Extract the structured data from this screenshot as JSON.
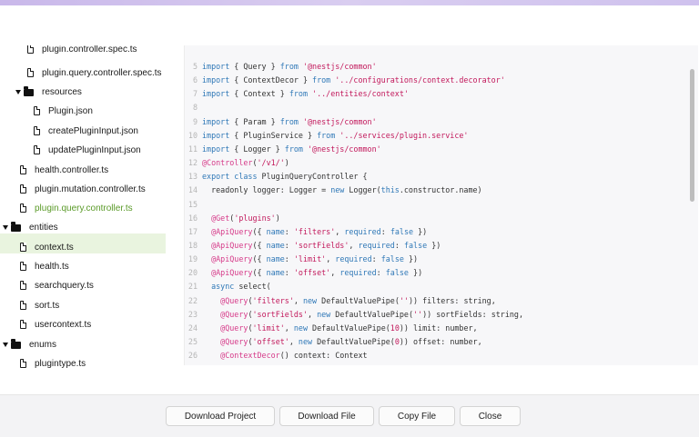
{
  "tree": {
    "items": [
      {
        "label": "plugin.controller.spec.ts",
        "type": "file"
      },
      {
        "label": "plugin.query.controller.spec.ts",
        "type": "file"
      },
      {
        "label": "resources",
        "type": "folder"
      },
      {
        "label": "Plugin.json",
        "type": "file"
      },
      {
        "label": "createPluginInput.json",
        "type": "file"
      },
      {
        "label": "updatePluginInput.json",
        "type": "file"
      },
      {
        "label": "health.controller.ts",
        "type": "file"
      },
      {
        "label": "plugin.mutation.controller.ts",
        "type": "file"
      },
      {
        "label": "plugin.query.controller.ts",
        "type": "file",
        "selected": true
      },
      {
        "label": "entities",
        "type": "folder"
      },
      {
        "label": "context.ts",
        "type": "file"
      },
      {
        "label": "health.ts",
        "type": "file"
      },
      {
        "label": "searchquery.ts",
        "type": "file"
      },
      {
        "label": "sort.ts",
        "type": "file"
      },
      {
        "label": "usercontext.ts",
        "type": "file"
      },
      {
        "label": "enums",
        "type": "folder"
      },
      {
        "label": "plugintype.ts",
        "type": "file"
      }
    ]
  },
  "editor": {
    "lines": [
      {
        "n": "5",
        "segs": [
          [
            "kw",
            "import"
          ],
          [
            "plain",
            " { Query } "
          ],
          [
            "kw",
            "from"
          ],
          [
            "plain",
            " "
          ],
          [
            "str",
            "'@nestjs/common'"
          ]
        ]
      },
      {
        "n": "6",
        "segs": [
          [
            "kw",
            "import"
          ],
          [
            "plain",
            " { ContextDecor } "
          ],
          [
            "kw",
            "from"
          ],
          [
            "plain",
            " "
          ],
          [
            "str",
            "'../configurations/context.decorator'"
          ]
        ]
      },
      {
        "n": "7",
        "segs": [
          [
            "kw",
            "import"
          ],
          [
            "plain",
            " { Context } "
          ],
          [
            "kw",
            "from"
          ],
          [
            "plain",
            " "
          ],
          [
            "str",
            "'../entities/context'"
          ]
        ]
      },
      {
        "n": "8",
        "segs": []
      },
      {
        "n": "9",
        "segs": [
          [
            "kw",
            "import"
          ],
          [
            "plain",
            " { Param } "
          ],
          [
            "kw",
            "from"
          ],
          [
            "plain",
            " "
          ],
          [
            "str",
            "'@nestjs/common'"
          ]
        ]
      },
      {
        "n": "10",
        "segs": [
          [
            "kw",
            "import"
          ],
          [
            "plain",
            " { PluginService } "
          ],
          [
            "kw",
            "from"
          ],
          [
            "plain",
            " "
          ],
          [
            "str",
            "'../services/plugin.service'"
          ]
        ]
      },
      {
        "n": "11",
        "segs": [
          [
            "kw",
            "import"
          ],
          [
            "plain",
            " { Logger } "
          ],
          [
            "kw",
            "from"
          ],
          [
            "plain",
            " "
          ],
          [
            "str",
            "'@nestjs/common'"
          ]
        ]
      },
      {
        "n": "12",
        "segs": [
          [
            "dec",
            "@Controller"
          ],
          [
            "plain",
            "("
          ],
          [
            "str",
            "'/v1/'"
          ],
          [
            "plain",
            ")"
          ]
        ]
      },
      {
        "n": "13",
        "segs": [
          [
            "kw",
            "export class"
          ],
          [
            "plain",
            " PluginQueryController {"
          ]
        ]
      },
      {
        "n": "14",
        "segs": [
          [
            "plain",
            "  readonly logger: Logger = "
          ],
          [
            "kw",
            "new"
          ],
          [
            "plain",
            " Logger("
          ],
          [
            "kw",
            "this"
          ],
          [
            "plain",
            ".constructor.name)"
          ]
        ]
      },
      {
        "n": "15",
        "segs": []
      },
      {
        "n": "16",
        "segs": [
          [
            "plain",
            "  "
          ],
          [
            "dec",
            "@Get"
          ],
          [
            "plain",
            "("
          ],
          [
            "str",
            "'plugins'"
          ],
          [
            "plain",
            ")"
          ]
        ]
      },
      {
        "n": "17",
        "segs": [
          [
            "plain",
            "  "
          ],
          [
            "dec",
            "@ApiQuery"
          ],
          [
            "plain",
            "({ "
          ],
          [
            "kw",
            "name"
          ],
          [
            "plain",
            ": "
          ],
          [
            "str",
            "'filters'"
          ],
          [
            "plain",
            ", "
          ],
          [
            "kw",
            "required"
          ],
          [
            "plain",
            ": "
          ],
          [
            "kw",
            "false"
          ],
          [
            "plain",
            " })"
          ]
        ]
      },
      {
        "n": "18",
        "segs": [
          [
            "plain",
            "  "
          ],
          [
            "dec",
            "@ApiQuery"
          ],
          [
            "plain",
            "({ "
          ],
          [
            "kw",
            "name"
          ],
          [
            "plain",
            ": "
          ],
          [
            "str",
            "'sortFields'"
          ],
          [
            "plain",
            ", "
          ],
          [
            "kw",
            "required"
          ],
          [
            "plain",
            ": "
          ],
          [
            "kw",
            "false"
          ],
          [
            "plain",
            " })"
          ]
        ]
      },
      {
        "n": "19",
        "segs": [
          [
            "plain",
            "  "
          ],
          [
            "dec",
            "@ApiQuery"
          ],
          [
            "plain",
            "({ "
          ],
          [
            "kw",
            "name"
          ],
          [
            "plain",
            ": "
          ],
          [
            "str",
            "'limit'"
          ],
          [
            "plain",
            ", "
          ],
          [
            "kw",
            "required"
          ],
          [
            "plain",
            ": "
          ],
          [
            "kw",
            "false"
          ],
          [
            "plain",
            " })"
          ]
        ]
      },
      {
        "n": "20",
        "segs": [
          [
            "plain",
            "  "
          ],
          [
            "dec",
            "@ApiQuery"
          ],
          [
            "plain",
            "({ "
          ],
          [
            "kw",
            "name"
          ],
          [
            "plain",
            ": "
          ],
          [
            "str",
            "'offset'"
          ],
          [
            "plain",
            ", "
          ],
          [
            "kw",
            "required"
          ],
          [
            "plain",
            ": "
          ],
          [
            "kw",
            "false"
          ],
          [
            "plain",
            " })"
          ]
        ]
      },
      {
        "n": "21",
        "segs": [
          [
            "plain",
            "  "
          ],
          [
            "kw",
            "async"
          ],
          [
            "plain",
            " select("
          ]
        ]
      },
      {
        "n": "22",
        "segs": [
          [
            "plain",
            "    "
          ],
          [
            "dec",
            "@Query"
          ],
          [
            "plain",
            "("
          ],
          [
            "str",
            "'filters'"
          ],
          [
            "plain",
            ", "
          ],
          [
            "kw",
            "new"
          ],
          [
            "plain",
            " DefaultValuePipe("
          ],
          [
            "str",
            "''"
          ],
          [
            "plain",
            ")) filters: string,"
          ]
        ]
      },
      {
        "n": "23",
        "segs": [
          [
            "plain",
            "    "
          ],
          [
            "dec",
            "@Query"
          ],
          [
            "plain",
            "("
          ],
          [
            "str",
            "'sortFields'"
          ],
          [
            "plain",
            ", "
          ],
          [
            "kw",
            "new"
          ],
          [
            "plain",
            " DefaultValuePipe("
          ],
          [
            "str",
            "''"
          ],
          [
            "plain",
            ")) sortFields: string,"
          ]
        ]
      },
      {
        "n": "24",
        "segs": [
          [
            "plain",
            "    "
          ],
          [
            "dec",
            "@Query"
          ],
          [
            "plain",
            "("
          ],
          [
            "str",
            "'limit'"
          ],
          [
            "plain",
            ", "
          ],
          [
            "kw",
            "new"
          ],
          [
            "plain",
            " DefaultValuePipe("
          ],
          [
            "str",
            "10"
          ],
          [
            "plain",
            ")) limit: number,"
          ]
        ]
      },
      {
        "n": "25",
        "segs": [
          [
            "plain",
            "    "
          ],
          [
            "dec",
            "@Query"
          ],
          [
            "plain",
            "("
          ],
          [
            "str",
            "'offset'"
          ],
          [
            "plain",
            ", "
          ],
          [
            "kw",
            "new"
          ],
          [
            "plain",
            " DefaultValuePipe("
          ],
          [
            "str",
            "0"
          ],
          [
            "plain",
            ")) offset: number,"
          ]
        ]
      },
      {
        "n": "26",
        "segs": [
          [
            "plain",
            "    "
          ],
          [
            "dec",
            "@ContextDecor"
          ],
          [
            "plain",
            "() context: Context"
          ]
        ]
      }
    ]
  },
  "footer": {
    "download_project": "Download Project",
    "download_file": "Download File",
    "copy_file": "Copy File",
    "close": "Close"
  },
  "colors": {
    "keyword": "#2f78b7",
    "string": "#c2185b",
    "decorator": "#d63a89",
    "selected_file": "#5a9a28",
    "selected_bg": "#e9f4df"
  }
}
